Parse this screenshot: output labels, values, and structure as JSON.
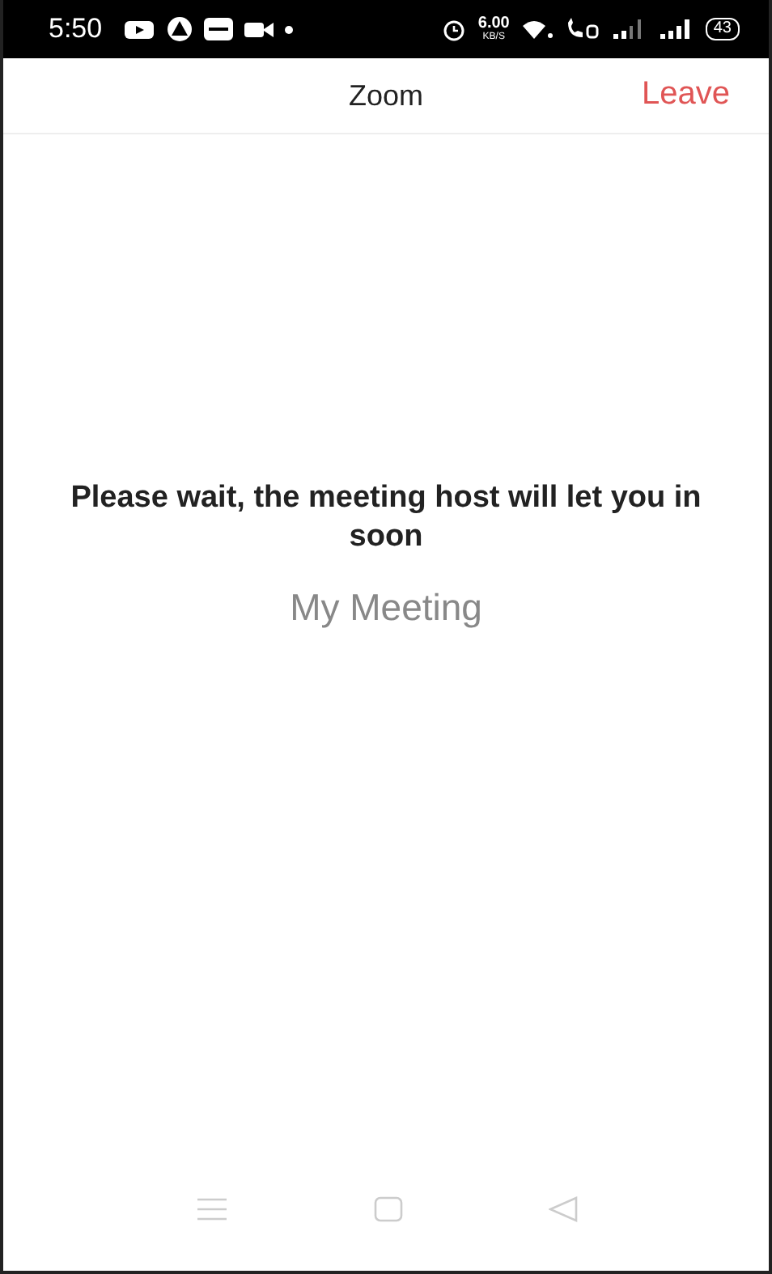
{
  "status_bar": {
    "time": "5:50",
    "speed": "6.00",
    "speed_unit": "KB/S",
    "battery": "43"
  },
  "header": {
    "title": "Zoom",
    "leave": "Leave"
  },
  "message": "Please wait, the meeting host will let you in soon",
  "meeting_name": "My Meeting"
}
